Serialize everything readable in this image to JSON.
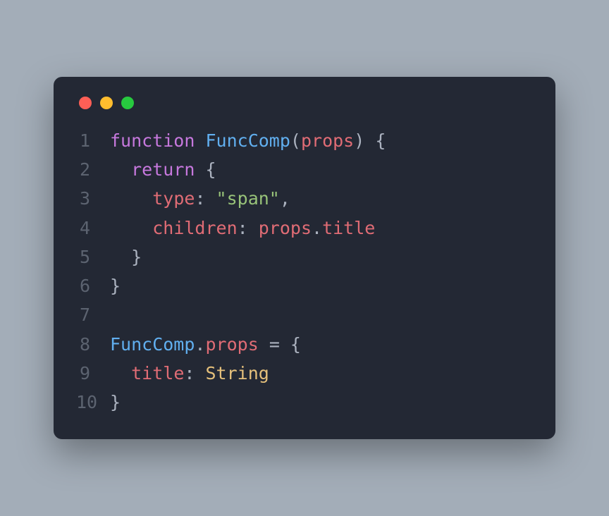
{
  "code": {
    "lines": [
      {
        "num": "1",
        "tokens": [
          {
            "cls": "tok-keyword",
            "text": "function"
          },
          {
            "cls": "tok-default",
            "text": " "
          },
          {
            "cls": "tok-func",
            "text": "FuncComp"
          },
          {
            "cls": "tok-punc",
            "text": "("
          },
          {
            "cls": "tok-param",
            "text": "props"
          },
          {
            "cls": "tok-punc",
            "text": ") {"
          }
        ]
      },
      {
        "num": "2",
        "tokens": [
          {
            "cls": "tok-default",
            "text": "  "
          },
          {
            "cls": "tok-keyword",
            "text": "return"
          },
          {
            "cls": "tok-default",
            "text": " "
          },
          {
            "cls": "tok-punc",
            "text": "{"
          }
        ]
      },
      {
        "num": "3",
        "tokens": [
          {
            "cls": "tok-default",
            "text": "    "
          },
          {
            "cls": "tok-prop",
            "text": "type"
          },
          {
            "cls": "tok-punc",
            "text": ": "
          },
          {
            "cls": "tok-string",
            "text": "\"span\""
          },
          {
            "cls": "tok-punc",
            "text": ","
          }
        ]
      },
      {
        "num": "4",
        "tokens": [
          {
            "cls": "tok-default",
            "text": "    "
          },
          {
            "cls": "tok-prop",
            "text": "children"
          },
          {
            "cls": "tok-punc",
            "text": ": "
          },
          {
            "cls": "tok-var",
            "text": "props"
          },
          {
            "cls": "tok-punc",
            "text": "."
          },
          {
            "cls": "tok-member",
            "text": "title"
          }
        ]
      },
      {
        "num": "5",
        "tokens": [
          {
            "cls": "tok-default",
            "text": "  "
          },
          {
            "cls": "tok-punc",
            "text": "}"
          }
        ]
      },
      {
        "num": "6",
        "tokens": [
          {
            "cls": "tok-punc",
            "text": "}"
          }
        ]
      },
      {
        "num": "7",
        "tokens": [
          {
            "cls": "tok-default",
            "text": ""
          }
        ]
      },
      {
        "num": "8",
        "tokens": [
          {
            "cls": "tok-func",
            "text": "FuncComp"
          },
          {
            "cls": "tok-punc",
            "text": "."
          },
          {
            "cls": "tok-member",
            "text": "props"
          },
          {
            "cls": "tok-default",
            "text": " "
          },
          {
            "cls": "tok-punc",
            "text": "= {"
          }
        ]
      },
      {
        "num": "9",
        "tokens": [
          {
            "cls": "tok-default",
            "text": "  "
          },
          {
            "cls": "tok-prop",
            "text": "title"
          },
          {
            "cls": "tok-punc",
            "text": ": "
          },
          {
            "cls": "tok-type",
            "text": "String"
          }
        ]
      },
      {
        "num": "10",
        "tokens": [
          {
            "cls": "tok-punc",
            "text": "}"
          }
        ]
      }
    ]
  }
}
